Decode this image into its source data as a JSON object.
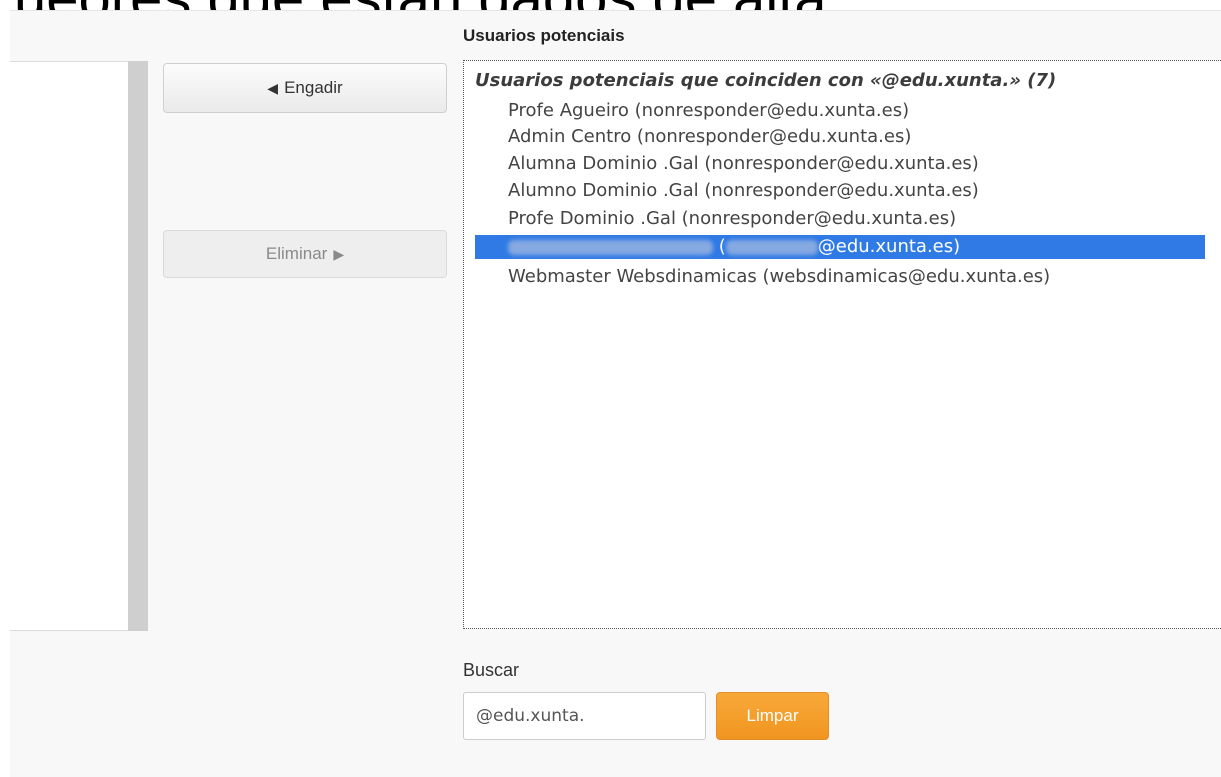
{
  "page": {
    "heading_fragment": "ueores que están dados de alta."
  },
  "buttons": {
    "add_label": "Engadir",
    "remove_label": "Eliminar"
  },
  "icons": {
    "add": "triangle-left-icon",
    "remove": "triangle-right-icon"
  },
  "potential_users": {
    "section_label": "Usuarios potenciais",
    "group_label": "Usuarios potenciais que coinciden con «@edu.xunta.» (7)",
    "options": [
      {
        "label": "Profe Agueiro (nonresponder@edu.xunta.es)",
        "selected": false
      },
      {
        "label": "Admin Centro (nonresponder@edu.xunta.es)",
        "selected": false
      },
      {
        "label": "Alumna Dominio .Gal (nonresponder@edu.xunta.es)",
        "selected": false
      },
      {
        "label": "Alumno Dominio .Gal (nonresponder@edu.xunta.es)",
        "selected": false
      },
      {
        "label": "Profe Dominio .Gal (nonresponder@edu.xunta.es)",
        "selected": false
      },
      {
        "label": "@edu.xunta.es)",
        "selected": true
      },
      {
        "label": "Webmaster Websdinamicas (websdinamicas@edu.xunta.es)",
        "selected": false
      }
    ]
  },
  "search": {
    "label": "Buscar",
    "value": "@edu.xunta.",
    "clear_label": "Limpar"
  },
  "colors": {
    "selection": "#2f7ae5",
    "clear_button": "#f39b27"
  }
}
